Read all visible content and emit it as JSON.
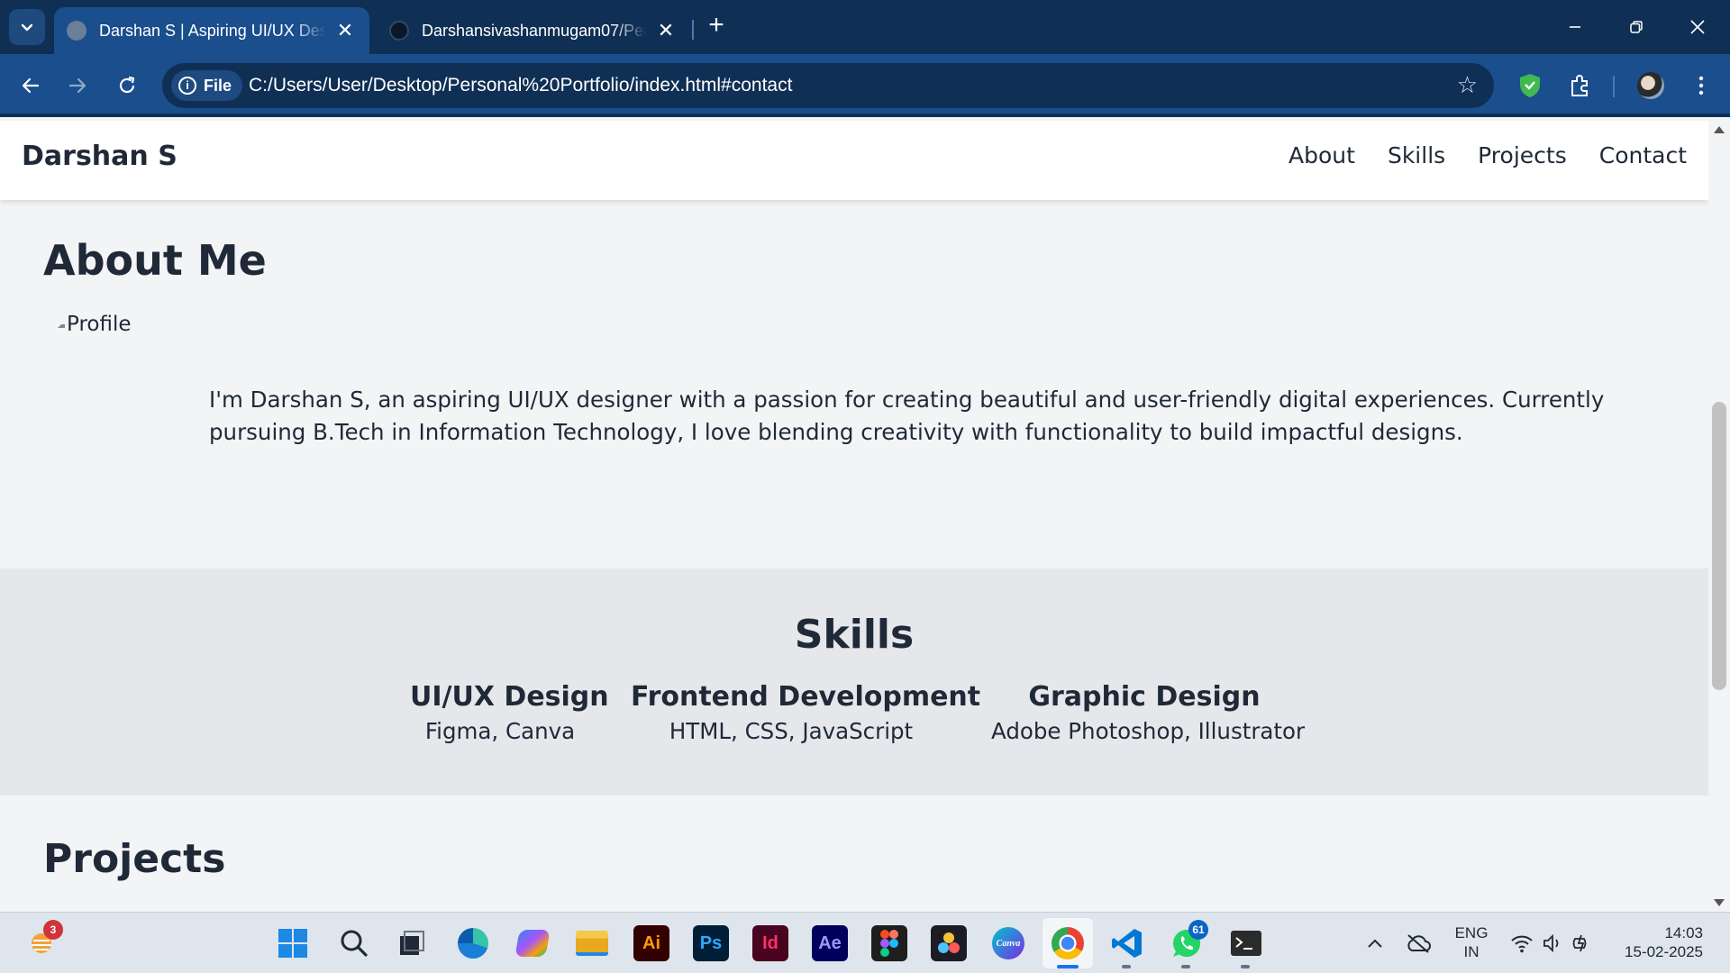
{
  "browser": {
    "tabs": [
      {
        "title": "Darshan S | Aspiring UI/UX Designer",
        "active": true
      },
      {
        "title": "Darshansivashanmugam07/Personal-Portfolio",
        "active": false
      }
    ],
    "address": {
      "chip_label": "File",
      "url": "C:/Users/User/Desktop/Personal%20Portfolio/index.html#contact"
    },
    "colors": {
      "tabbar": "#0f2f55",
      "toolbar": "#1a4e8c"
    }
  },
  "site": {
    "brand": "Darshan S",
    "nav": [
      "About",
      "Skills",
      "Projects",
      "Contact"
    ],
    "about": {
      "heading": "About Me",
      "image_alt": "Profile",
      "text": "I'm Darshan S, an aspiring UI/UX designer with a passion for creating beautiful and user-friendly digital experiences. Currently pursuing B.Tech in Information Technology, I love blending creativity with functionality to build impactful designs."
    },
    "skills": {
      "heading": "Skills",
      "items": [
        {
          "name": "UI/UX Design",
          "tools": "Figma, Canva"
        },
        {
          "name": "Frontend Development",
          "tools": "HTML, CSS, JavaScript"
        },
        {
          "name": "Graphic Design",
          "tools": "Adobe Photoshop, Illustrator"
        }
      ]
    },
    "projects": {
      "heading": "Projects"
    }
  },
  "taskbar": {
    "weather_badge": "3",
    "apps": [
      "windows-start",
      "search",
      "task-view",
      "edge",
      "copilot",
      "file-explorer",
      "illustrator",
      "photoshop",
      "indesign",
      "after-effects",
      "figma",
      "davinci-resolve",
      "canva",
      "chrome",
      "vscode",
      "whatsapp",
      "terminal"
    ],
    "app_labels": {
      "illustrator": "Ai",
      "photoshop": "Ps",
      "indesign": "Id",
      "after_effects": "Ae",
      "canva": "Canva"
    },
    "whatsapp_badge": "61",
    "language": "ENG",
    "region": "IN",
    "time": "14:03",
    "date": "15-02-2025"
  }
}
